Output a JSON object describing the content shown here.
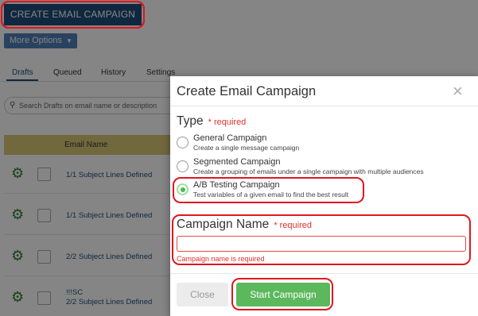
{
  "header": {
    "create_button": "CREATE EMAIL CAMPAIGN",
    "more_options": "More Options"
  },
  "tabs": [
    {
      "label": "Drafts"
    },
    {
      "label": "Queued"
    },
    {
      "label": "History"
    },
    {
      "label": "Settings"
    }
  ],
  "search": {
    "placeholder": "Search Drafts on email name or description"
  },
  "table": {
    "column_email_name": "Email Name",
    "rows": [
      {
        "line1": "1/1 Subject Lines Defined",
        "line2": ""
      },
      {
        "line1": "1/1 Subject Lines Defined",
        "line2": ""
      },
      {
        "line1": "2/2 Subject Lines Defined",
        "line2": ""
      },
      {
        "line1": "!!!SC",
        "line2": "2/2 Subject Lines Defined"
      }
    ]
  },
  "modal": {
    "title": "Create Email Campaign",
    "close_icon": "×",
    "type_label": "Type",
    "required_text": "* required",
    "options": [
      {
        "title": "General Campaign",
        "description": "Create a single message campaign",
        "selected": false
      },
      {
        "title": "Segmented Campaign",
        "description": "Create a grouping of emails under a single campaign with multiple audiences",
        "selected": false
      },
      {
        "title": "A/B Testing Campaign",
        "description": "Test variables of a given email to find the best result",
        "selected": true
      }
    ],
    "name_label": "Campaign Name",
    "name_required": "* required",
    "name_value": "",
    "name_error": "Campaign name is required",
    "close_button": "Close",
    "start_button": "Start Campaign"
  },
  "colors": {
    "primary": "#1f4e79",
    "highlight": "#e0161f",
    "success": "#5cb85c",
    "error": "#e03131",
    "table_header": "#d8c878"
  }
}
